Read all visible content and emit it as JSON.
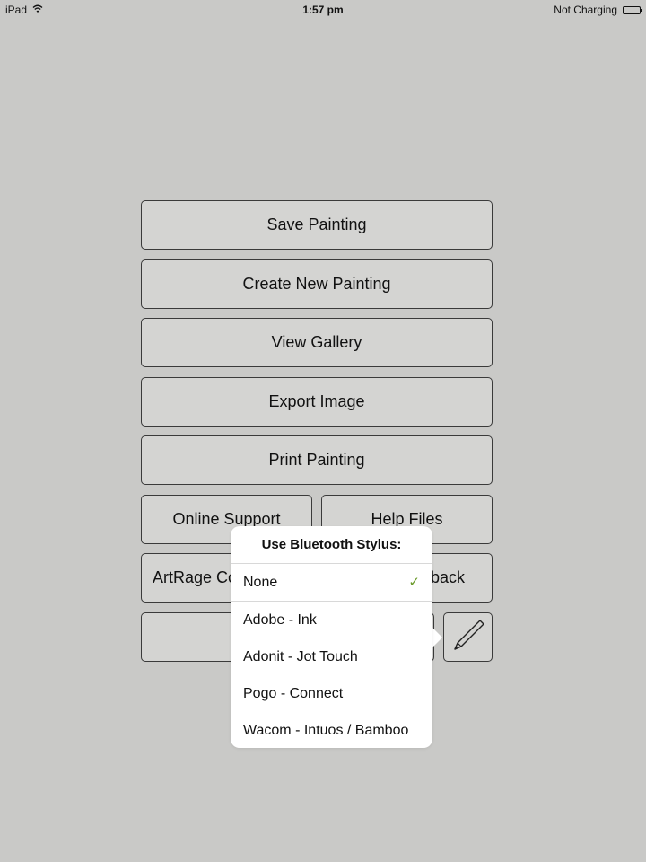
{
  "status_bar": {
    "device": "iPad",
    "time": "1:57 pm",
    "battery_status": "Not Charging",
    "wifi_icon": "wifi-icon",
    "battery_icon": "battery-icon"
  },
  "menu": {
    "save": "Save Painting",
    "create_new": "Create New Painting",
    "view_gallery": "View Gallery",
    "export_image": "Export Image",
    "print": "Print Painting",
    "online_support": "Online Support",
    "help_files": "Help Files",
    "artrage_community": "ArtRage Co",
    "feedback": "back",
    "stylus_icon": "pen-icon"
  },
  "popover": {
    "title": "Use Bluetooth Stylus:",
    "selected_index": 0,
    "options": [
      {
        "label": "None",
        "selected": true
      },
      {
        "label": "Adobe - Ink",
        "selected": false
      },
      {
        "label": "Adonit - Jot Touch",
        "selected": false
      },
      {
        "label": "Pogo - Connect",
        "selected": false
      },
      {
        "label": "Wacom - Intuos / Bamboo",
        "selected": false
      }
    ],
    "check_glyph": "✓",
    "check_color": "#6a9a2a"
  }
}
